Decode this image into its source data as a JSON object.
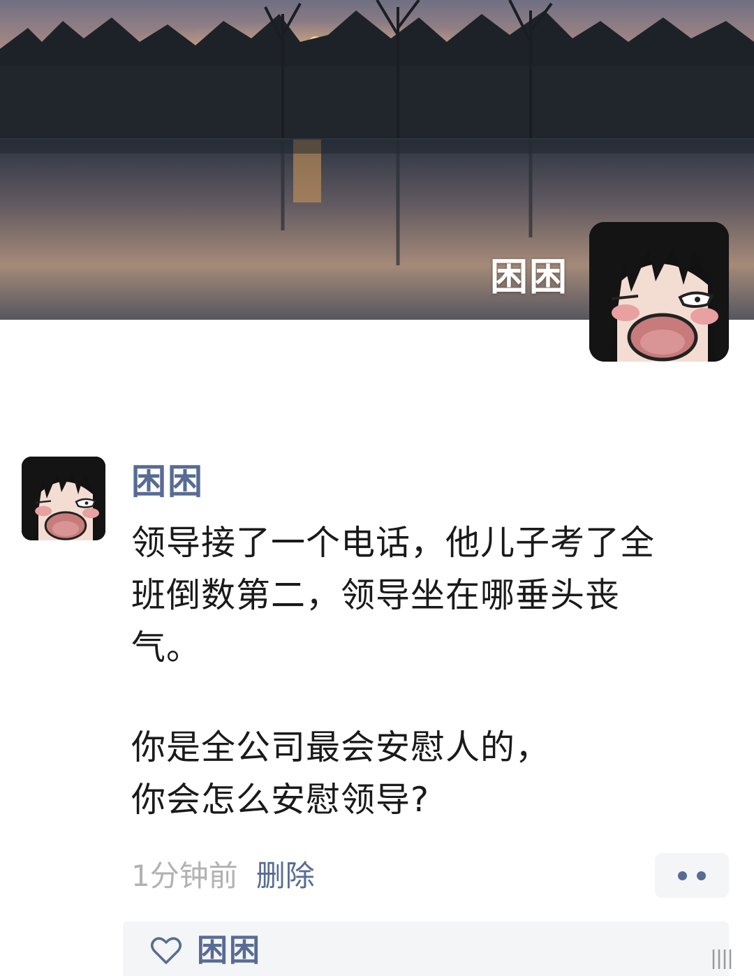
{
  "cover": {
    "name": "困困"
  },
  "post": {
    "author": "困困",
    "lines": [
      "领导接了一个电话，他儿子考了全",
      "班倒数第二，领导坐在哪垂头丧",
      "气。",
      "你是全公司最会安慰人的，",
      "你会怎么安慰领导?"
    ],
    "time": "1分钟前",
    "delete_label": "删除"
  },
  "likes": {
    "names": "困困"
  },
  "colors": {
    "link": "#576b95",
    "meta": "#b2b2b2",
    "text": "#1a1a1a",
    "panel": "#f4f5f6"
  },
  "icons": {
    "more": "more-dots-icon",
    "like": "heart-icon",
    "avatar": "anime-girl-avatar-icon",
    "scroll": "scroll-indicator-icon"
  }
}
